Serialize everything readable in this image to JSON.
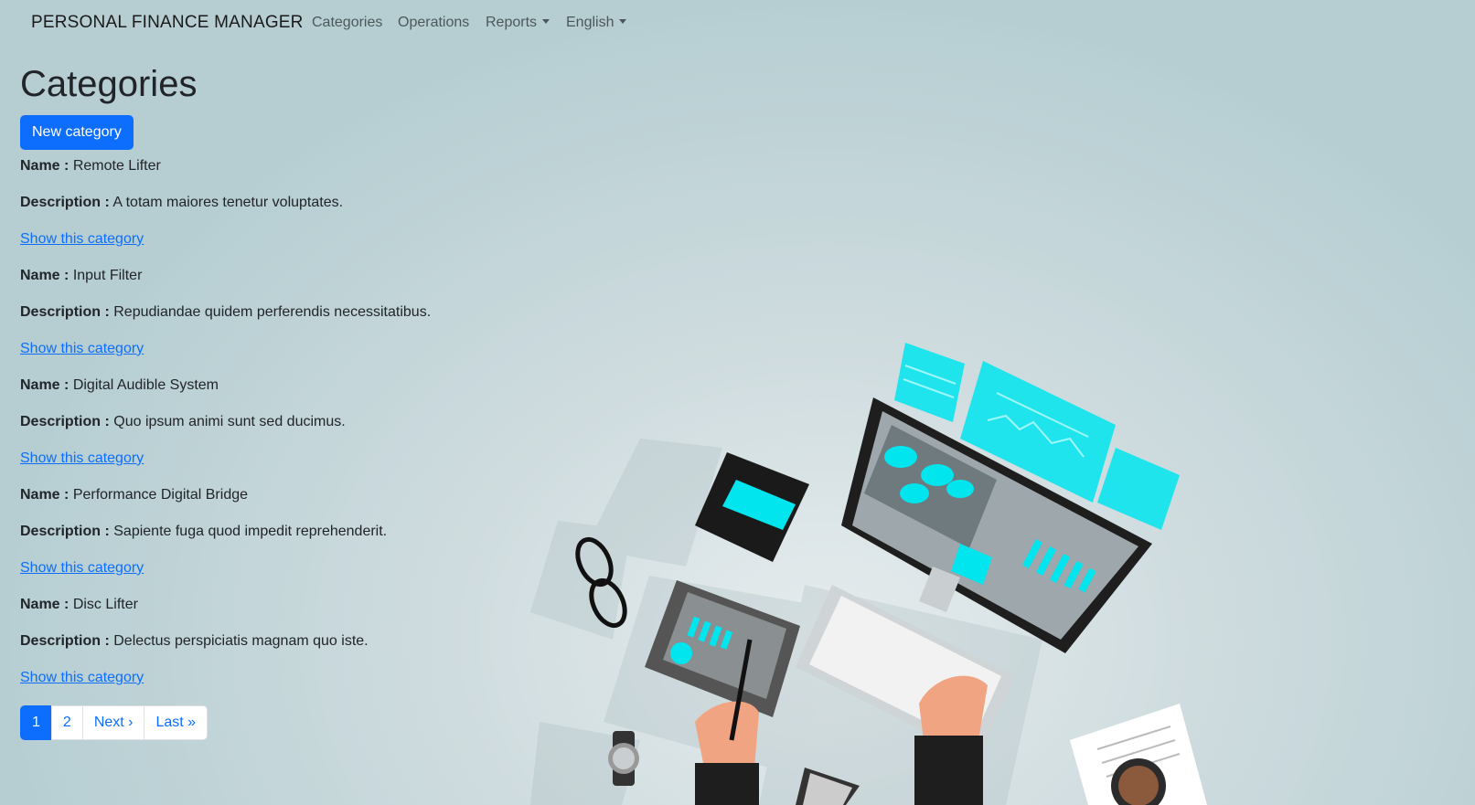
{
  "navbar": {
    "brand": "PERSONAL FINANCE MANAGER",
    "links": {
      "categories": "Categories",
      "operations": "Operations",
      "reports": "Reports",
      "language": "English"
    }
  },
  "page": {
    "title": "Categories",
    "new_button": "New category"
  },
  "labels": {
    "name": "Name :",
    "description": "Description :",
    "show_link": "Show this category"
  },
  "categories": [
    {
      "name": "Remote Lifter",
      "description": "A totam maiores tenetur voluptates."
    },
    {
      "name": "Input Filter",
      "description": "Repudiandae quidem perferendis necessitatibus."
    },
    {
      "name": "Digital Audible System",
      "description": "Quo ipsum animi sunt sed ducimus."
    },
    {
      "name": "Performance Digital Bridge",
      "description": "Sapiente fuga quod impedit reprehenderit."
    },
    {
      "name": "Disc Lifter",
      "description": "Delectus perspiciatis magnam quo iste."
    }
  ],
  "pagination": {
    "pages": [
      "1",
      "2"
    ],
    "active": "1",
    "next": "Next ›",
    "last": "Last »"
  },
  "colors": {
    "primary": "#0d6efd",
    "accent_cyan": "#00e5ee"
  }
}
